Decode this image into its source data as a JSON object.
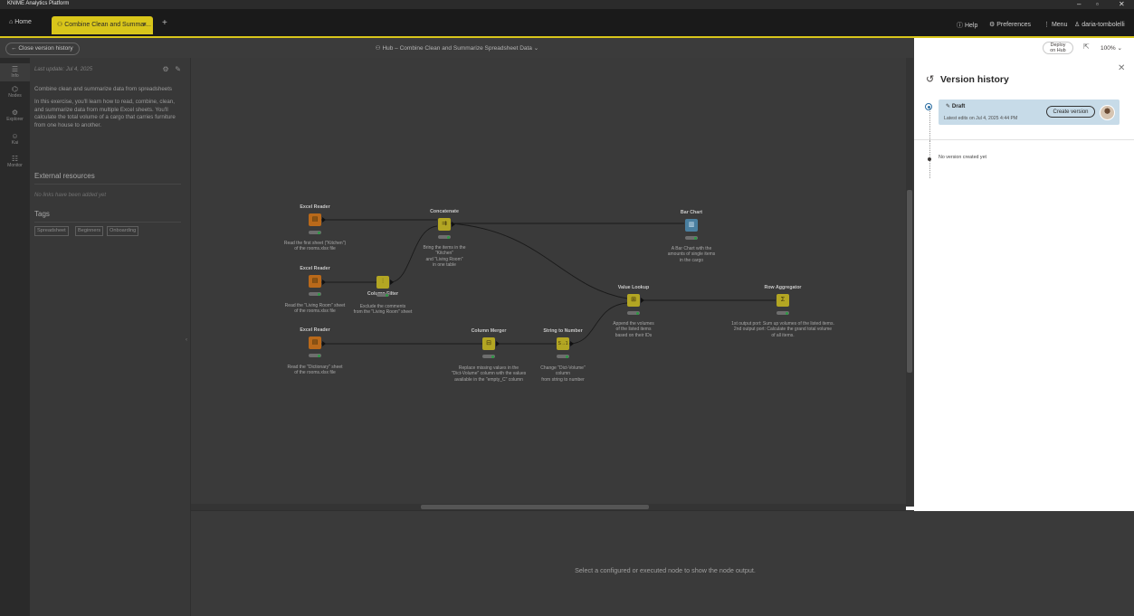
{
  "app": {
    "title": "KNIME Analytics Platform"
  },
  "tabs": {
    "home_label": "Home",
    "active_label": "Combine Clean and Summar...",
    "close_glyph": "×",
    "add_glyph": "+"
  },
  "topbar": {
    "help": "Help",
    "preferences": "Preferences",
    "menu": "Menu",
    "user": "daria-tombolelli"
  },
  "breadcrumb": {
    "close_version_history": "Close version history",
    "hub_path": "Hub – Combine Clean and Summarize Spreadsheet Data"
  },
  "nav": {
    "items": [
      {
        "label": "Info"
      },
      {
        "label": "Nodes"
      },
      {
        "label": "Explorer"
      },
      {
        "label": "Kai"
      },
      {
        "label": "Monitor"
      }
    ]
  },
  "info": {
    "last_update": "Last update: Jul 4, 2025",
    "description_title": "Combine clean and summarize data from spreadsheets",
    "description_body": "In this exercise, you'll learn how to read, combine, clean, and summarize data from multiple Excel sheets. You'll calculate the total volume of a cargo that carries furniture from one house to another.",
    "external_resources_heading": "External resources",
    "no_links": "No links have been added yet",
    "tags_heading": "Tags",
    "tags": [
      "Spreadsheet",
      "Beginners",
      "Onboarding"
    ]
  },
  "workflow": {
    "nodes": [
      {
        "id": "excel1",
        "name": "Excel Reader",
        "label1": "Read the first sheet (\"Kitchen\")",
        "label2": "of the rooms.xlsx file",
        "label3": "",
        "kind": "src"
      },
      {
        "id": "excel2",
        "name": "Excel Reader",
        "label1": "Read the \"Living Room\" sheet",
        "label2": "of the rooms.xlsx file",
        "label3": "",
        "kind": "src"
      },
      {
        "id": "excel3",
        "name": "Excel Reader",
        "label1": "Read the \"Dictionary\" sheet",
        "label2": "of the rooms.xlsx file",
        "label3": "",
        "kind": "src"
      },
      {
        "id": "colfilter",
        "name": "Column Filter",
        "label1": "Exclude the comments",
        "label2": "from the \"Living Room\" sheet",
        "label3": "",
        "kind": "man"
      },
      {
        "id": "concat",
        "name": "Concatenate",
        "label1": "Bring the items in the",
        "label2": "\"Kitchen\"",
        "label3": "and \"Living Room\"",
        "label4": "in one table",
        "kind": "man"
      },
      {
        "id": "barchart",
        "name": "Bar Chart",
        "label1": "A Bar Chart with the",
        "label2": "amounts of single items",
        "label3": "in the cargo",
        "kind": "vis"
      },
      {
        "id": "valuelookup",
        "name": "Value Lookup",
        "label1": "Append the volumes",
        "label2": "of the listed items",
        "label3": "based on their IDs",
        "kind": "man"
      },
      {
        "id": "rowagg",
        "name": "Row Aggregator",
        "label1": "1st output port: Sum up volumes of the listed items.",
        "label2": "2nd output port: Calculate the grand total volume",
        "label3": "of all items.",
        "kind": "man"
      },
      {
        "id": "colmerger",
        "name": "Column Merger",
        "label1": "Replace missing values in the",
        "label2": "\"Dict-Volume\" column with the values",
        "label3": "available in the \"empty_C\" column",
        "kind": "man"
      },
      {
        "id": "str2num",
        "name": "String to Number",
        "label1": "Change \"Dict-Volume\"",
        "label2": "column",
        "label3": "from string to number",
        "kind": "man"
      }
    ]
  },
  "output": {
    "empty_message": "Select a configured or executed node to show the node output."
  },
  "version_history": {
    "deploy_line1": "Deploy",
    "deploy_line2": "on Hub",
    "zoom": "100%",
    "title": "Version history",
    "draft_name": "Draft",
    "draft_sub": "Latest edits on Jul 4, 2025 4:44 PM",
    "create_button": "Create version",
    "no_versions": "No version created yet"
  },
  "colors": {
    "accent": "#d9c61a",
    "draft_card": "#c7dbe8",
    "source_node": "#b9691a",
    "manipulator_node": "#b3a623",
    "visualizer_node": "#4a7fa0"
  }
}
